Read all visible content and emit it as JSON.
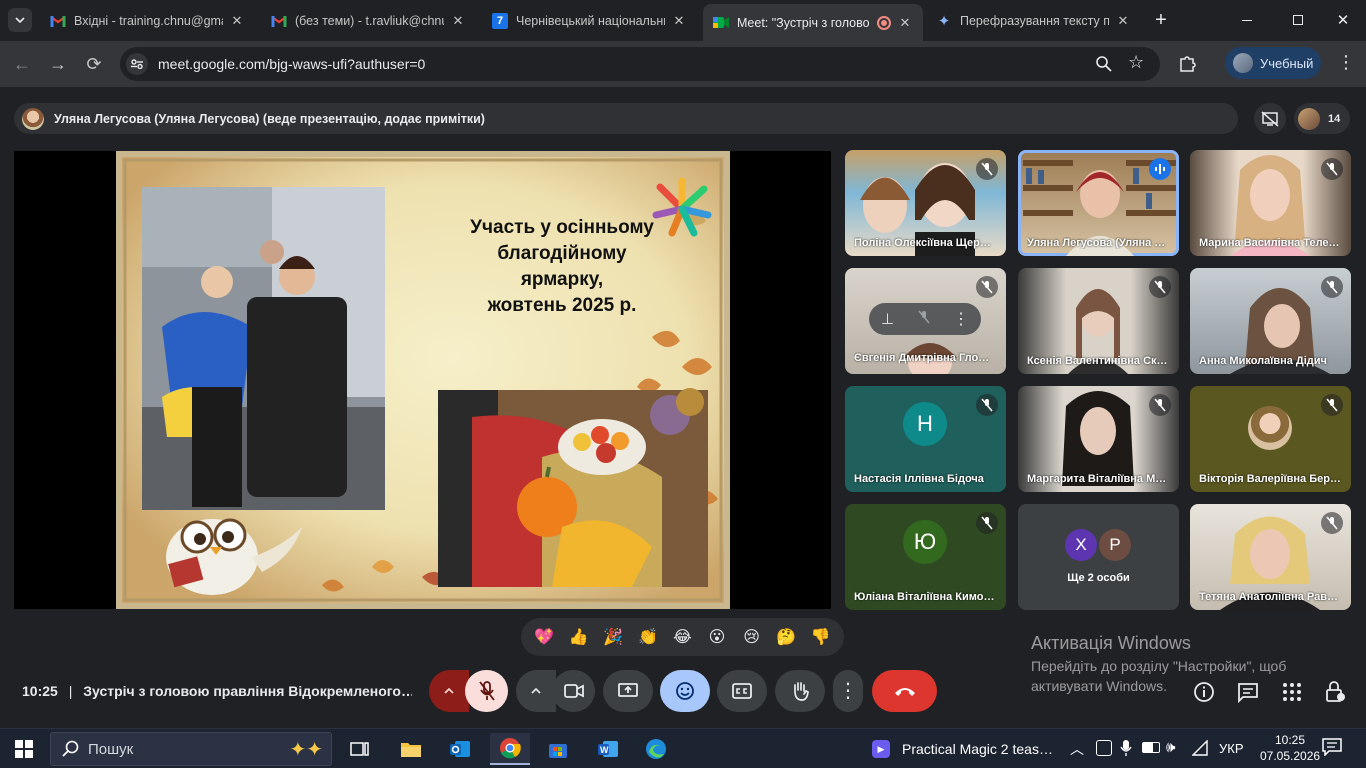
{
  "browser": {
    "tabs": [
      {
        "title": "Вхідні - training.chnu@gmai",
        "favicon": "gmail-icon"
      },
      {
        "title": "(без теми) - t.ravliuk@chnu.",
        "favicon": "gmail-icon"
      },
      {
        "title": "Чернівецький національни",
        "favicon": "7"
      },
      {
        "title": "Meet: \"Зустріч з голово",
        "favicon": "meet-icon"
      },
      {
        "title": "Перефразування тексту пр",
        "favicon": "gemini-icon"
      }
    ],
    "url": "meet.google.com/bjg-waws-ufi?authuser=0",
    "profile_label": "Учебный"
  },
  "meet": {
    "presenter_banner": "Уляна Легусова (Уляна Легусова) (веде презентацію, додає примітки)",
    "participant_count": "14",
    "slide": {
      "title_lines": [
        "Участь у осінньому",
        "благодійному",
        "ярмарку,",
        "жовтень 2025 р."
      ]
    },
    "participants": [
      {
        "name": "Поліна Олексіївна Щер…"
      },
      {
        "name": "Уляна Легусова (Уляна …"
      },
      {
        "name": "Марина Василівна Теле…"
      },
      {
        "name": "Євгенія Дмитрівна Гло…"
      },
      {
        "name": "Ксенія Валентинівна Ск…"
      },
      {
        "name": "Анна Миколаївна Дідич"
      },
      {
        "name": "Настасія Іллівна Бідоча",
        "initial": "Н"
      },
      {
        "name": "Маргарита Віталіївна М…"
      },
      {
        "name": "Вікторія Валеріївна Бер…"
      },
      {
        "name": "Юліана Віталіївна Кимо…",
        "initial": "Ю"
      },
      {
        "name": "Ще 2 особи",
        "initials": [
          "Х",
          "Р"
        ]
      },
      {
        "name": "Тетяна Анатоліївна Рав…"
      }
    ],
    "reactions": [
      "💖",
      "👍",
      "🎉",
      "👏",
      "😂",
      "😮",
      "😢",
      "🤔",
      "👎"
    ],
    "meeting_time": "10:25",
    "meeting_separator": "|",
    "meeting_title": "Зустріч з головою правління Відокремленого…"
  },
  "activation": {
    "title": "Активація Windows",
    "line1": "Перейдіть до розділу \"Настройки\", щоб",
    "line2": "активувати Windows."
  },
  "taskbar": {
    "search_placeholder": "Пошук",
    "media_title": "Practical Magic 2 teas…",
    "lang": "УКР",
    "time": "10:25",
    "date": "07.05.2026"
  },
  "colors": {
    "accent": "#8ab4f8",
    "end_call": "#ea4335",
    "mic_off_bg": "#f9dedc",
    "mic_chevron_bg": "#8c1d18"
  }
}
